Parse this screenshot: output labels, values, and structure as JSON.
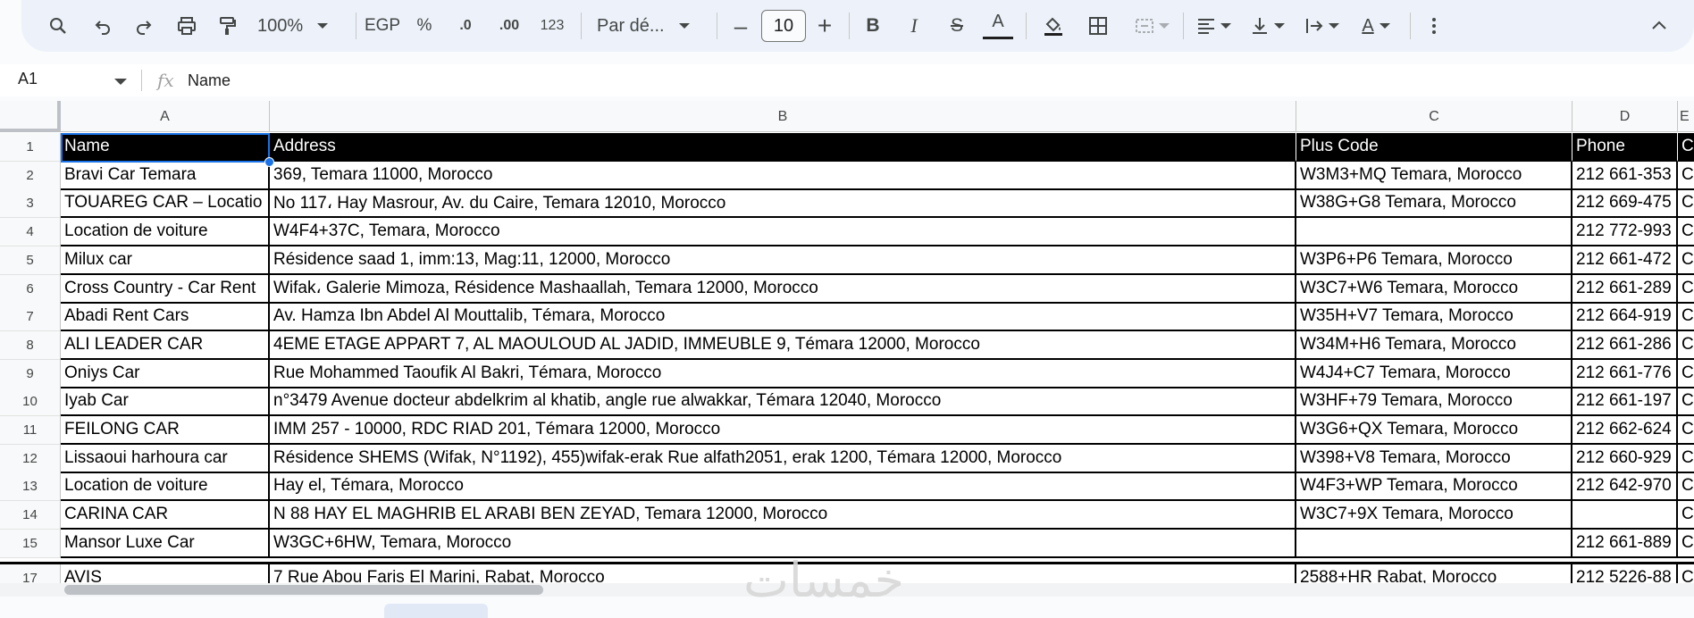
{
  "toolbar": {
    "zoom": "100%",
    "currency": "EGP",
    "percent": "%",
    "decrease_decimals": ".0",
    "increase_decimals": ".00",
    "number_format": "123",
    "font_family": "Par dé...",
    "font_size": "10",
    "bold": "B",
    "italic": "I",
    "strike": "S",
    "text_color": "A",
    "text_rotate": "A"
  },
  "formula_bar": {
    "cell_ref": "A1",
    "fx": "fx",
    "value": "Name"
  },
  "columns": [
    {
      "label": "A"
    },
    {
      "label": "B"
    },
    {
      "label": "C"
    },
    {
      "label": "D"
    },
    {
      "label": "E"
    }
  ],
  "rows": [
    {
      "num": "1",
      "name": "Name",
      "address": "Address",
      "plus": "Plus Code",
      "phone": "Phone",
      "e": "C"
    },
    {
      "num": "2",
      "name": "Bravi Car Temara",
      "address": "369, Temara 11000, Morocco",
      "plus": "W3M3+MQ Temara, Morocco",
      "phone": "212 661-353",
      "e": "C"
    },
    {
      "num": "3",
      "name": "TOUAREG CAR – Locatio",
      "address": "No 117، Hay Masrour, Av. du Caire, Temara 12010, Morocco",
      "plus": "W38G+G8 Temara, Morocco",
      "phone": "212 669-475",
      "e": "C"
    },
    {
      "num": "4",
      "name": "Location de voiture",
      "address": "W4F4+37C, Temara, Morocco",
      "plus": "",
      "phone": "212 772-993",
      "e": "C"
    },
    {
      "num": "5",
      "name": "Milux car",
      "address": "Résidence saad 1, imm:13, Mag:11, 12000, Morocco",
      "plus": "W3P6+P6 Temara, Morocco",
      "phone": "212 661-472",
      "e": "C"
    },
    {
      "num": "6",
      "name": "Cross Country - Car Rent",
      "address": "Wifak، Galerie Mimoza, Résidence Mashaallah, Temara 12000, Morocco",
      "plus": "W3C7+W6 Temara, Morocco",
      "phone": "212 661-289",
      "e": "C"
    },
    {
      "num": "7",
      "name": "Abadi Rent Cars",
      "address": "Av. Hamza Ibn Abdel Al Mouttalib, Témara, Morocco",
      "plus": "W35H+V7 Temara, Morocco",
      "phone": "212 664-919",
      "e": "C"
    },
    {
      "num": "8",
      "name": "ALI LEADER CAR",
      "address": "4EME ETAGE APPART 7, AL MAOULOUD AL JADID, IMMEUBLE 9, Témara 12000, Morocco",
      "plus": "W34M+H6 Temara, Morocco",
      "phone": "212 661-286",
      "e": "C"
    },
    {
      "num": "9",
      "name": "Oniys Car",
      "address": "Rue Mohammed Taoufik Al Bakri, Témara, Morocco",
      "plus": "W4J4+C7 Temara, Morocco",
      "phone": "212 661-776",
      "e": "C"
    },
    {
      "num": "10",
      "name": "Iyab Car",
      "address": "n°3479 Avenue docteur abdelkrim al khatib, angle rue alwakkar, Témara 12040, Morocco",
      "plus": "W3HF+79 Temara, Morocco",
      "phone": "212 661-197",
      "e": "C"
    },
    {
      "num": "11",
      "name": "FEILONG CAR",
      "address": "IMM 257 - 10000, RDC RIAD 201, Témara 12000, Morocco",
      "plus": "W3G6+QX Temara, Morocco",
      "phone": "212 662-624",
      "e": "C"
    },
    {
      "num": "12",
      "name": "Lissaoui harhoura car",
      "address": "Résidence SHEMS (Wifak, N°1192), 455)wifak-erak Rue alfath2051, erak 1200, Témara 12000, Morocco",
      "plus": "W398+V8 Temara, Morocco",
      "phone": "212 660-929",
      "e": "C"
    },
    {
      "num": "13",
      "name": "Location de voiture",
      "address": "Hay el, Témara, Morocco",
      "plus": "W4F3+WP Temara, Morocco",
      "phone": "212 642-970",
      "e": "C"
    },
    {
      "num": "14",
      "name": "CARINA CAR",
      "address": "N 88 HAY EL MAGHRIB EL ARABI BEN ZEYAD, Temara 12000, Morocco",
      "plus": "W3C7+9X Temara, Morocco",
      "phone": "",
      "e": "C"
    },
    {
      "num": "15",
      "name": "Mansor Luxe Car",
      "address": "W3GC+6HW, Temara, Morocco",
      "plus": "",
      "phone": "212 661-889",
      "e": "C"
    },
    {
      "num": "17",
      "name": "AVIS",
      "address": "7 Rue Abou Faris El Marini, Rabat, Morocco",
      "plus": "2588+HR Rabat, Morocco",
      "phone": "212 5226-88",
      "e": "C"
    }
  ],
  "watermark": "خمسات"
}
